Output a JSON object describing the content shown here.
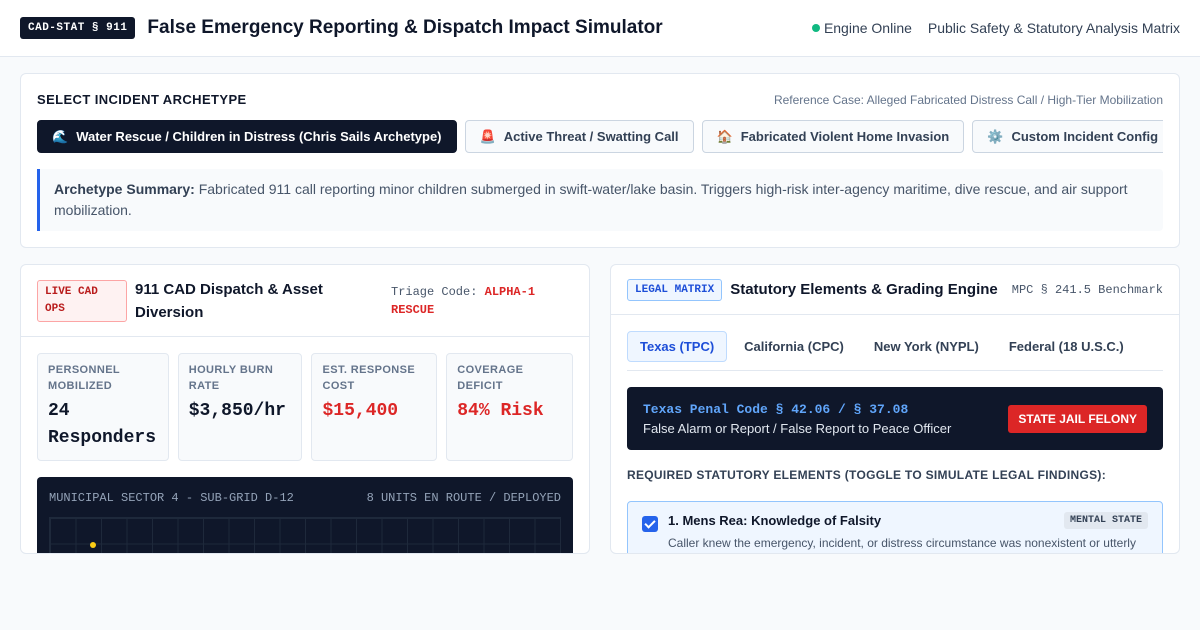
{
  "header": {
    "badge": "CAD-STAT § 911",
    "title": "False Emergency Reporting & Dispatch Impact Simulator",
    "status": "Engine Online",
    "subtitle": "Public Safety & Statutory Analysis Matrix",
    "status_color": "#10b981"
  },
  "archetype": {
    "section_label": "SELECT INCIDENT ARCHETYPE",
    "reference": "Reference Case: Alleged Fabricated Distress Call / High-Tier Mobilization",
    "tabs": [
      {
        "icon": "🌊",
        "icon_name": "wave-icon",
        "label": "Water Rescue / Children in Distress (Chris Sails Archetype)",
        "active": true
      },
      {
        "icon": "🚨",
        "icon_name": "siren-icon",
        "label": "Active Threat / Swatting Call",
        "active": false
      },
      {
        "icon": "🏠",
        "icon_name": "house-icon",
        "label": "Fabricated Violent Home Invasion",
        "active": false
      },
      {
        "icon": "⚙️",
        "icon_name": "gear-icon",
        "label": "Custom Incident Config",
        "active": false
      }
    ],
    "summary_label": "Archetype Summary:",
    "summary_text": "Fabricated 911 call reporting minor children submerged in swift-water/lake basin. Triggers high-risk inter-agency maritime, dive rescue, and air support mobilization."
  },
  "dispatch": {
    "badge": "LIVE CAD OPS",
    "title": "911 CAD Dispatch & Asset Diversion",
    "triage_label": "Triage Code:",
    "triage_code": "ALPHA-1 RESCUE",
    "metrics": [
      {
        "label": "PERSONNEL MOBILIZED",
        "value": "24 Responders",
        "red": false
      },
      {
        "label": "HOURLY BURN RATE",
        "value": "$3,850/hr",
        "red": false
      },
      {
        "label": "EST. RESPONSE COST",
        "value": "$15,400",
        "red": true
      },
      {
        "label": "COVERAGE DEFICIT",
        "value": "84% Risk",
        "red": true
      }
    ],
    "map_title": "MUNICIPAL SECTOR 4 - SUB-GRID D-12",
    "map_status": "8 UNITS EN ROUTE / DEPLOYED"
  },
  "legal": {
    "badge": "LEGAL MATRIX",
    "title": "Statutory Elements & Grading Engine",
    "benchmark": "MPC § 241.5 Benchmark",
    "jurisdictions": [
      {
        "label": "Texas (TPC)",
        "active": true
      },
      {
        "label": "California (CPC)",
        "active": false
      },
      {
        "label": "New York (NYPL)",
        "active": false
      },
      {
        "label": "Federal (18 U.S.C.)",
        "active": false
      }
    ],
    "statute_code": "Texas Penal Code § 42.06 / § 37.08",
    "statute_desc": "False Alarm or Report / False Report to Peace Officer",
    "grade": "STATE JAIL FELONY",
    "elements_label": "REQUIRED STATUTORY ELEMENTS (TOGGLE TO SIMULATE LEGAL FINDINGS):",
    "elements": [
      {
        "title": "1. Mens Rea: Knowledge of Falsity",
        "tag": "MENTAL STATE",
        "desc": "Caller knew the emergency, incident, or distress circumstance was nonexistent or utterly",
        "checked": true
      }
    ]
  }
}
